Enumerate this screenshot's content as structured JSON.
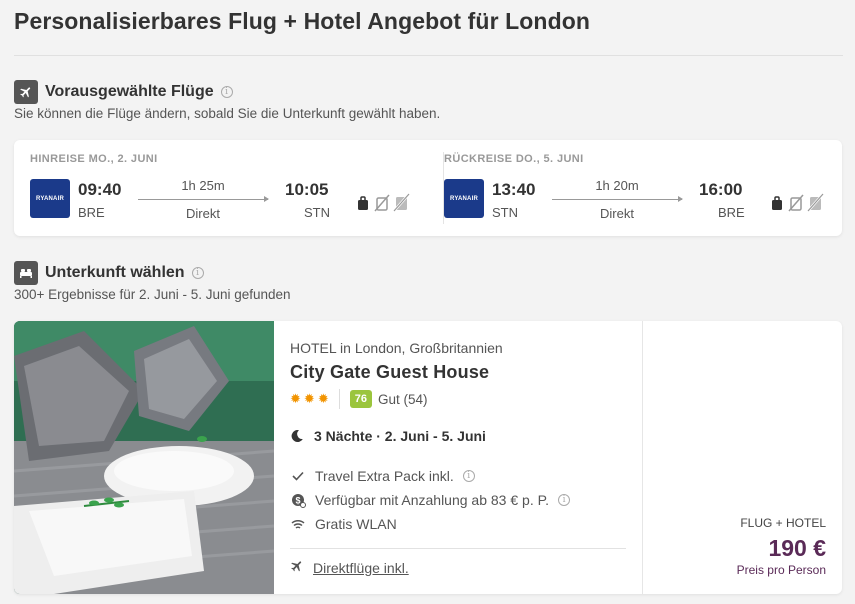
{
  "page": {
    "title": "Personalisierbares Flug + Hotel Angebot für London"
  },
  "flights_section": {
    "title": "Vorausgewählte Flüge",
    "subtitle": "Sie können die Flüge ändern, sobald Sie die Unterkunft gewählt haben."
  },
  "outbound": {
    "label": "HINREISE MO., 2. JUNI",
    "airline": "RYANAIR",
    "dep_time": "09:40",
    "dep_code": "BRE",
    "duration": "1h 25m",
    "stops": "Direkt",
    "arr_time": "10:05",
    "arr_code": "STN"
  },
  "inbound": {
    "label": "RÜCKREISE DO., 5. JUNI",
    "airline": "RYANAIR",
    "dep_time": "13:40",
    "dep_code": "STN",
    "duration": "1h 20m",
    "stops": "Direkt",
    "arr_time": "16:00",
    "arr_code": "BRE"
  },
  "accommodation_section": {
    "title": "Unterkunft wählen",
    "subtitle": "300+ Ergebnisse für 2. Juni - 5. Juni gefunden"
  },
  "hotel": {
    "location": "HOTEL in London, Großbritannien",
    "name": "City Gate Guest House",
    "stars": 3,
    "score": "76",
    "score_label": "Gut (54)",
    "stay": "3 Nächte · 2. Juni - 5. Juni",
    "features": [
      "Travel Extra Pack inkl.",
      "Verfügbar mit Anzahlung ab 83 € p. P.",
      "Gratis WLAN"
    ],
    "direct_flights": "Direktflüge inkl.",
    "price_kind": "FLUG + HOTEL",
    "price": "190 €",
    "price_note": "Preis pro Person"
  },
  "colors": {
    "accent_price": "#5a2a57",
    "score_bg": "#9bc53d",
    "star": "#f29400",
    "ryanair": "#1b3a8a"
  }
}
